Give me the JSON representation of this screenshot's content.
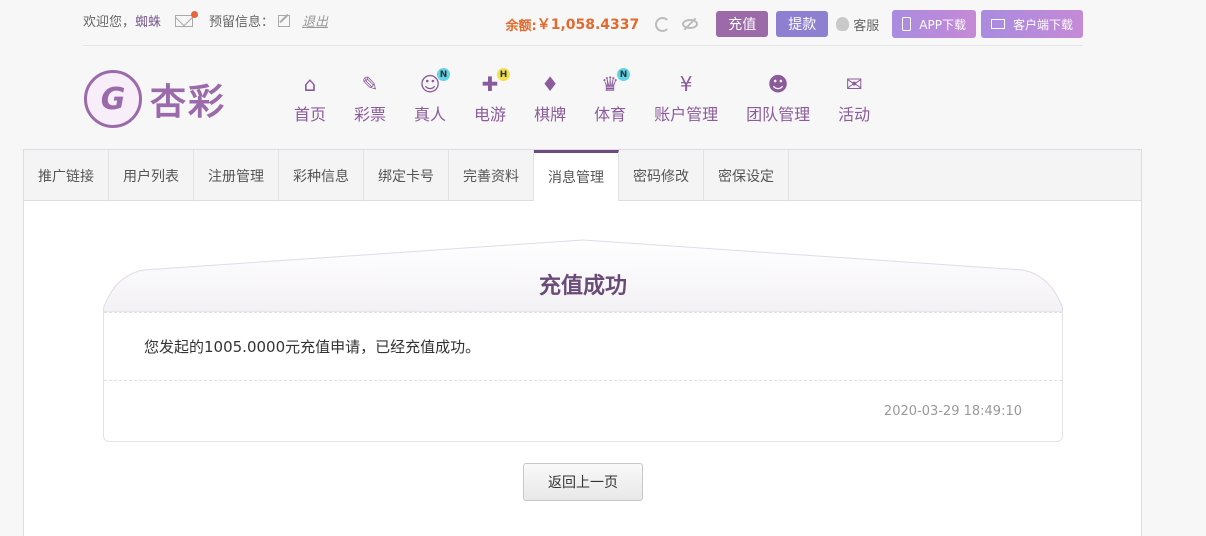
{
  "topbar": {
    "welcome": "欢迎您，",
    "username": "蜘蛛",
    "reserved_label": "预留信息：",
    "logout": "退出",
    "balance_label": "余额:",
    "balance_value": "￥1,058.4337",
    "charge": "充值",
    "withdraw": "提款",
    "service": "客服",
    "app_download": "APP下载",
    "client_download": "客户端下载"
  },
  "logo": {
    "mark": "G",
    "text": "杏彩"
  },
  "nav": [
    {
      "label": "首页",
      "icon": "home-icon",
      "glyph": "⌂",
      "badge": ""
    },
    {
      "label": "彩票",
      "icon": "ticket-icon",
      "glyph": "✎",
      "badge": ""
    },
    {
      "label": "真人",
      "icon": "live-dealer-icon",
      "glyph": "☺",
      "badge": "N"
    },
    {
      "label": "电游",
      "icon": "gamepad-icon",
      "glyph": "✚",
      "badge": "H"
    },
    {
      "label": "棋牌",
      "icon": "cards-icon",
      "glyph": "♦",
      "badge": ""
    },
    {
      "label": "体育",
      "icon": "trophy-icon",
      "glyph": "♛",
      "badge": "N"
    },
    {
      "label": "账户管理",
      "icon": "account-icon",
      "glyph": "¥",
      "badge": ""
    },
    {
      "label": "团队管理",
      "icon": "team-icon",
      "glyph": "☻",
      "badge": ""
    },
    {
      "label": "活动",
      "icon": "gift-icon",
      "glyph": "✉",
      "badge": ""
    }
  ],
  "subnav": [
    "推广链接",
    "用户列表",
    "注册管理",
    "彩种信息",
    "绑定卡号",
    "完善资料",
    "消息管理",
    "密码修改",
    "密保设定"
  ],
  "message": {
    "title": "充值成功",
    "body": "您发起的1005.0000元充值申请，已经充值成功。",
    "time": "2020-03-29 18:49:10",
    "back": "返回上一页"
  },
  "colors": {
    "accent": "#9b6aab",
    "balance": "#e26a2c",
    "title": "#6a4b78"
  }
}
